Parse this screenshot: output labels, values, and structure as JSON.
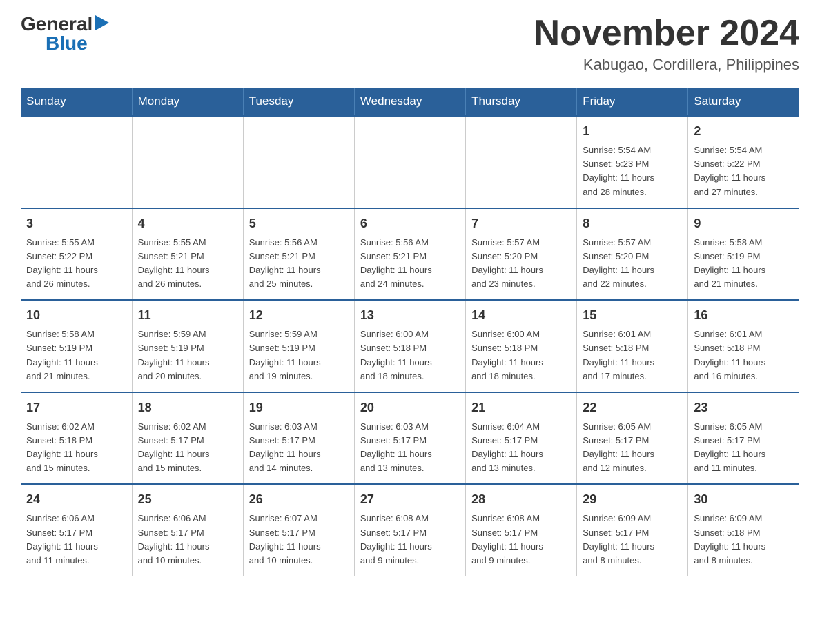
{
  "logo": {
    "general": "General",
    "blue": "Blue",
    "arrow": "▶"
  },
  "title": "November 2024",
  "subtitle": "Kabugao, Cordillera, Philippines",
  "days_of_week": [
    "Sunday",
    "Monday",
    "Tuesday",
    "Wednesday",
    "Thursday",
    "Friday",
    "Saturday"
  ],
  "weeks": [
    [
      {
        "day": "",
        "info": ""
      },
      {
        "day": "",
        "info": ""
      },
      {
        "day": "",
        "info": ""
      },
      {
        "day": "",
        "info": ""
      },
      {
        "day": "",
        "info": ""
      },
      {
        "day": "1",
        "info": "Sunrise: 5:54 AM\nSunset: 5:23 PM\nDaylight: 11 hours\nand 28 minutes."
      },
      {
        "day": "2",
        "info": "Sunrise: 5:54 AM\nSunset: 5:22 PM\nDaylight: 11 hours\nand 27 minutes."
      }
    ],
    [
      {
        "day": "3",
        "info": "Sunrise: 5:55 AM\nSunset: 5:22 PM\nDaylight: 11 hours\nand 26 minutes."
      },
      {
        "day": "4",
        "info": "Sunrise: 5:55 AM\nSunset: 5:21 PM\nDaylight: 11 hours\nand 26 minutes."
      },
      {
        "day": "5",
        "info": "Sunrise: 5:56 AM\nSunset: 5:21 PM\nDaylight: 11 hours\nand 25 minutes."
      },
      {
        "day": "6",
        "info": "Sunrise: 5:56 AM\nSunset: 5:21 PM\nDaylight: 11 hours\nand 24 minutes."
      },
      {
        "day": "7",
        "info": "Sunrise: 5:57 AM\nSunset: 5:20 PM\nDaylight: 11 hours\nand 23 minutes."
      },
      {
        "day": "8",
        "info": "Sunrise: 5:57 AM\nSunset: 5:20 PM\nDaylight: 11 hours\nand 22 minutes."
      },
      {
        "day": "9",
        "info": "Sunrise: 5:58 AM\nSunset: 5:19 PM\nDaylight: 11 hours\nand 21 minutes."
      }
    ],
    [
      {
        "day": "10",
        "info": "Sunrise: 5:58 AM\nSunset: 5:19 PM\nDaylight: 11 hours\nand 21 minutes."
      },
      {
        "day": "11",
        "info": "Sunrise: 5:59 AM\nSunset: 5:19 PM\nDaylight: 11 hours\nand 20 minutes."
      },
      {
        "day": "12",
        "info": "Sunrise: 5:59 AM\nSunset: 5:19 PM\nDaylight: 11 hours\nand 19 minutes."
      },
      {
        "day": "13",
        "info": "Sunrise: 6:00 AM\nSunset: 5:18 PM\nDaylight: 11 hours\nand 18 minutes."
      },
      {
        "day": "14",
        "info": "Sunrise: 6:00 AM\nSunset: 5:18 PM\nDaylight: 11 hours\nand 18 minutes."
      },
      {
        "day": "15",
        "info": "Sunrise: 6:01 AM\nSunset: 5:18 PM\nDaylight: 11 hours\nand 17 minutes."
      },
      {
        "day": "16",
        "info": "Sunrise: 6:01 AM\nSunset: 5:18 PM\nDaylight: 11 hours\nand 16 minutes."
      }
    ],
    [
      {
        "day": "17",
        "info": "Sunrise: 6:02 AM\nSunset: 5:18 PM\nDaylight: 11 hours\nand 15 minutes."
      },
      {
        "day": "18",
        "info": "Sunrise: 6:02 AM\nSunset: 5:17 PM\nDaylight: 11 hours\nand 15 minutes."
      },
      {
        "day": "19",
        "info": "Sunrise: 6:03 AM\nSunset: 5:17 PM\nDaylight: 11 hours\nand 14 minutes."
      },
      {
        "day": "20",
        "info": "Sunrise: 6:03 AM\nSunset: 5:17 PM\nDaylight: 11 hours\nand 13 minutes."
      },
      {
        "day": "21",
        "info": "Sunrise: 6:04 AM\nSunset: 5:17 PM\nDaylight: 11 hours\nand 13 minutes."
      },
      {
        "day": "22",
        "info": "Sunrise: 6:05 AM\nSunset: 5:17 PM\nDaylight: 11 hours\nand 12 minutes."
      },
      {
        "day": "23",
        "info": "Sunrise: 6:05 AM\nSunset: 5:17 PM\nDaylight: 11 hours\nand 11 minutes."
      }
    ],
    [
      {
        "day": "24",
        "info": "Sunrise: 6:06 AM\nSunset: 5:17 PM\nDaylight: 11 hours\nand 11 minutes."
      },
      {
        "day": "25",
        "info": "Sunrise: 6:06 AM\nSunset: 5:17 PM\nDaylight: 11 hours\nand 10 minutes."
      },
      {
        "day": "26",
        "info": "Sunrise: 6:07 AM\nSunset: 5:17 PM\nDaylight: 11 hours\nand 10 minutes."
      },
      {
        "day": "27",
        "info": "Sunrise: 6:08 AM\nSunset: 5:17 PM\nDaylight: 11 hours\nand 9 minutes."
      },
      {
        "day": "28",
        "info": "Sunrise: 6:08 AM\nSunset: 5:17 PM\nDaylight: 11 hours\nand 9 minutes."
      },
      {
        "day": "29",
        "info": "Sunrise: 6:09 AM\nSunset: 5:17 PM\nDaylight: 11 hours\nand 8 minutes."
      },
      {
        "day": "30",
        "info": "Sunrise: 6:09 AM\nSunset: 5:18 PM\nDaylight: 11 hours\nand 8 minutes."
      }
    ]
  ]
}
